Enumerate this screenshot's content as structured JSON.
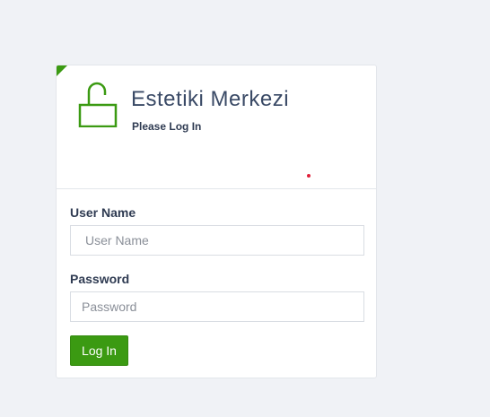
{
  "login": {
    "title": "Estetiki Merkezi",
    "subtitle": "Please Log In",
    "username_label": "User Name",
    "username_placeholder": "User Name",
    "password_label": "Password",
    "password_placeholder": "Password",
    "login_button": "Log In",
    "lock_icon": "unlocked-padlock-icon"
  },
  "colors": {
    "accent": "#3b9a12",
    "title": "#3a4a66",
    "background": "#f0f2f6",
    "dot": "#e0203a"
  }
}
